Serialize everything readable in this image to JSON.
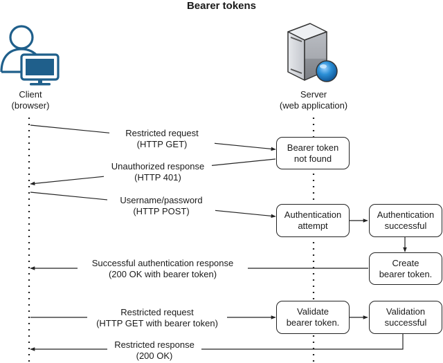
{
  "title": "Bearer tokens",
  "actors": {
    "client": {
      "name": "Client",
      "sub": "(browser)",
      "icon": "user-computer-icon",
      "icon_color": "#1f5f8b"
    },
    "server": {
      "name": "Server",
      "sub": "(web application)",
      "icon": "server-globe-icon",
      "globe_color": "#2b8fd6"
    }
  },
  "boxes": {
    "bearer_not_found": {
      "line1": "Bearer token",
      "line2": "not found"
    },
    "auth_attempt": {
      "line1": "Authentication",
      "line2": "attempt"
    },
    "auth_successful": {
      "line1": "Authentication",
      "line2": "successful"
    },
    "create_token": {
      "line1": "Create",
      "line2": "bearer token."
    },
    "validate_token": {
      "line1": "Validate",
      "line2": "bearer token."
    },
    "validation_successful": {
      "line1": "Validation",
      "line2": "successful"
    }
  },
  "messages": {
    "restricted_request_1": {
      "line1": "Restricted request",
      "line2": "(HTTP GET)",
      "direction": "client-to-server"
    },
    "unauthorized_response": {
      "line1": "Unauthorized response",
      "line2": "(HTTP 401)",
      "direction": "server-to-client"
    },
    "credentials": {
      "line1": "Username/password",
      "line2": "(HTTP POST)",
      "direction": "client-to-server"
    },
    "auth_response": {
      "line1": "Successful authentication response",
      "line2": "(200 OK with bearer token)",
      "direction": "server-to-client"
    },
    "restricted_request_2": {
      "line1": "Restricted request",
      "line2": "(HTTP GET with bearer token)",
      "direction": "client-to-server"
    },
    "restricted_response": {
      "line1": "Restricted response",
      "line2": "(200 OK)",
      "direction": "server-to-client"
    }
  }
}
